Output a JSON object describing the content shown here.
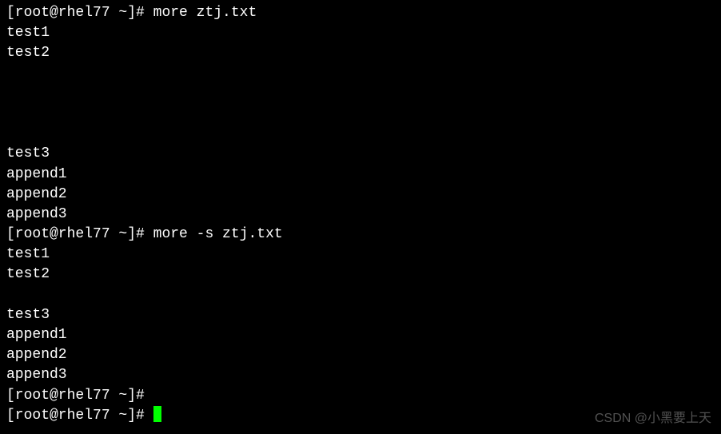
{
  "prompt": {
    "user": "root",
    "host": "rhel77",
    "dir": "~",
    "symbol": "#"
  },
  "commands": {
    "cmd1": "more ztj.txt",
    "cmd2": "more -s ztj.txt"
  },
  "output1": {
    "line1": "test1",
    "line2": "test2",
    "blank1": "",
    "blank2": "",
    "blank3": "",
    "blank4": "",
    "line3": "test3",
    "line4": "append1",
    "line5": "append2",
    "line6": "append3"
  },
  "output2": {
    "line1": "test1",
    "line2": "test2",
    "blank1": "",
    "line3": "test3",
    "line4": "append1",
    "line5": "append2",
    "line6": "append3"
  },
  "prompt_text": "[root@rhel77 ~]# ",
  "watermark": "CSDN @小黑要上天"
}
